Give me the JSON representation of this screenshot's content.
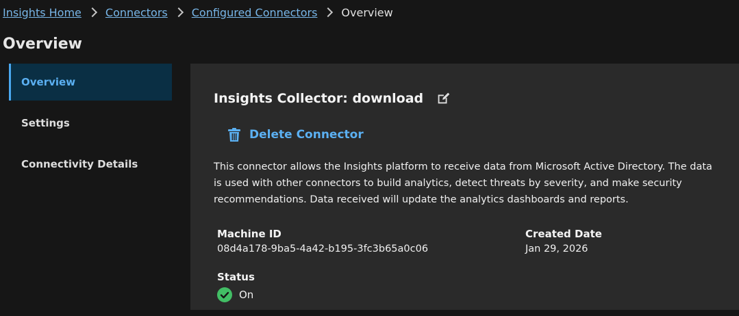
{
  "breadcrumb": {
    "items": [
      "Insights Home",
      "Connectors",
      "Configured Connectors"
    ],
    "current": "Overview"
  },
  "page": {
    "title": "Overview"
  },
  "sidenav": {
    "items": [
      {
        "label": "Overview",
        "active": true
      },
      {
        "label": "Settings",
        "active": false
      },
      {
        "label": "Connectivity Details",
        "active": false
      }
    ]
  },
  "connector": {
    "title": "Insights Collector: download",
    "delete_label": "Delete Connector",
    "description": "This connector allows the Insights platform to receive data from Microsoft Active Directory. The data is used with other connectors to build analytics, detect threats by severity, and make security recommendations. Data received will update the analytics dashboards and reports.",
    "machine_id_label": "Machine ID",
    "machine_id": "08d4a178-9ba5-4a42-b195-3fc3b65a0c06",
    "created_date_label": "Created Date",
    "created_date": "Jan 29, 2026",
    "status_label": "Status",
    "status": "On"
  },
  "icons": {
    "edit": "edit-icon",
    "delete": "trash-icon",
    "status": "check-circle-icon",
    "breadcrumb_separator": "chevron-right-icon"
  },
  "colors": {
    "link": "#78b6e8",
    "accent": "#4aa8f0",
    "active_nav_bg": "#0a2f44",
    "panel_bg": "#2a2a2a",
    "page_bg": "#161616",
    "status_ok": "#42be65"
  }
}
